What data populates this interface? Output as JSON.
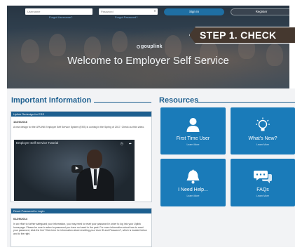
{
  "login": {
    "username_placeholder": "Username",
    "password_placeholder": "Password",
    "forgot_username": "Forgot Username?",
    "forgot_password": "Forgot Password?",
    "sign_in_label": "Sign In",
    "register_label": "Register"
  },
  "hero": {
    "logo_text": "gouplink",
    "welcome_text": "Welcome to Employer Self Service"
  },
  "annotation": {
    "step_label": "STEP 1. CHECK"
  },
  "important_information": {
    "title": "Important Information",
    "items": [
      {
        "heading": "Uplink Redesign for ESS",
        "date": "10/20/2016",
        "body": "A new design for the UPLINK Employer Self Service System (ESS) is coming in the Spring of 2017. Check out this video.",
        "video_title": "Employer Self Service Tutorial"
      },
      {
        "heading": "Reset Password to Login",
        "date": "01/29/2014",
        "body": "In an effort to further safeguard your information, you may need to reset your password in order to log into your Uplink homepage. Please be sure to select a password you have not used in the past. For more information about how to reset your password, click the link \"Click here for information about resetting your User ID and Password\", which is located below and to the right."
      }
    ]
  },
  "resources": {
    "title": "Resources",
    "tiles": [
      {
        "label": "First Time User",
        "more": "Learn More",
        "icon": "person-icon"
      },
      {
        "label": "What's New?",
        "more": "Learn More",
        "icon": "lightbulb-icon"
      },
      {
        "label": "I Need Help...",
        "more": "Learn More",
        "icon": "bell-icon"
      },
      {
        "label": "FAQs",
        "more": "Learn More",
        "icon": "chat-bubbles-icon"
      }
    ]
  },
  "colors": {
    "brand_blue": "#1d5f8f",
    "tile_blue": "#1a7bb9",
    "annotation_bg": "#45382f"
  }
}
